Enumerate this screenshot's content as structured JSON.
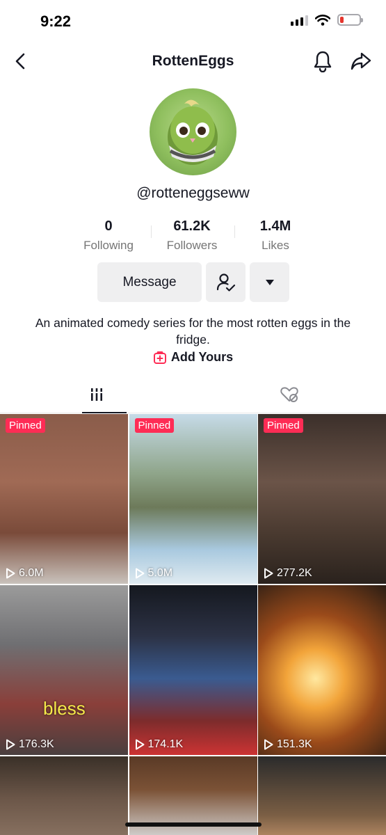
{
  "status_bar": {
    "time": "9:22"
  },
  "header": {
    "title": "RottenEggs"
  },
  "profile": {
    "username": "@rotteneggseww",
    "stats": [
      {
        "value": "0",
        "label": "Following"
      },
      {
        "value": "61.2K",
        "label": "Followers"
      },
      {
        "value": "1.4M",
        "label": "Likes"
      }
    ],
    "message_label": "Message",
    "bio": "An animated comedy series for the most rotten eggs in the fridge.",
    "add_yours_label": "Add Yours"
  },
  "videos": [
    {
      "pinned": "Pinned",
      "views": "6.0M"
    },
    {
      "pinned": "Pinned",
      "views": "5.0M"
    },
    {
      "pinned": "Pinned",
      "views": "277.2K"
    },
    {
      "views": "176.3K",
      "caption": "bless"
    },
    {
      "views": "174.1K"
    },
    {
      "views": "151.3K"
    }
  ],
  "colors": {
    "accent": "#fe2c55",
    "text": "#161823",
    "muted": "#757575",
    "button_bg": "#efeff0"
  },
  "icons": [
    "back-icon",
    "bell-icon",
    "share-icon",
    "friend-check-icon",
    "caret-down-icon",
    "add-yours-icon",
    "grid-videos-icon",
    "liked-hidden-icon",
    "play-icon"
  ]
}
